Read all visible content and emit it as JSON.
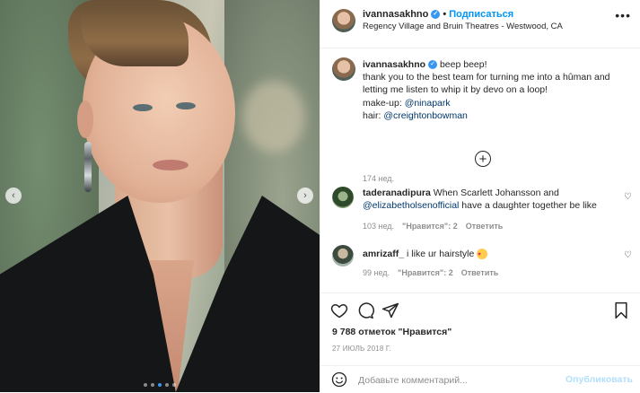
{
  "header": {
    "username": "ivannasakhno",
    "follow_label": "Подписаться",
    "location": "Regency Village and Bruin Theatres - Westwood, CA",
    "more_label": "•••"
  },
  "caption": {
    "username": "ivannasakhno",
    "line1": "beep beep!",
    "line2": "thank you to the best team for turning me into a hûman and letting me listen to whip it by devo on a loop!",
    "makeup_label": "make-up: ",
    "makeup_mention": "@ninapark",
    "hair_label": "hair: ",
    "hair_mention": "@creightonbowman",
    "time": "174 нед."
  },
  "comments": [
    {
      "username": "taderanadipura",
      "text_before": "When Scarlett Johansson and ",
      "mention": "@elizabetholsenofficial",
      "text_after": " have a daughter together be like",
      "time": "103 нед.",
      "likes": "\"Нравится\": 2",
      "reply": "Ответить"
    },
    {
      "username": "amrizaff_",
      "text": "i like ur hairstyle",
      "emoji": "heart-eyes-emoji",
      "time": "99 нед.",
      "likes": "\"Нравится\": 2",
      "reply": "Ответить"
    }
  ],
  "likes_count": "9 788 отметок \"Нравится\"",
  "date": "27 ИЮЛЬ 2018 Г.",
  "composer": {
    "placeholder": "Добавьте комментарий...",
    "publish_label": "Опубликовать"
  },
  "carousel": {
    "total": 5,
    "active_index": 2
  },
  "colors": {
    "accent": "#0095f6",
    "verified": "#3897f0",
    "muted": "#8e8e8e"
  }
}
